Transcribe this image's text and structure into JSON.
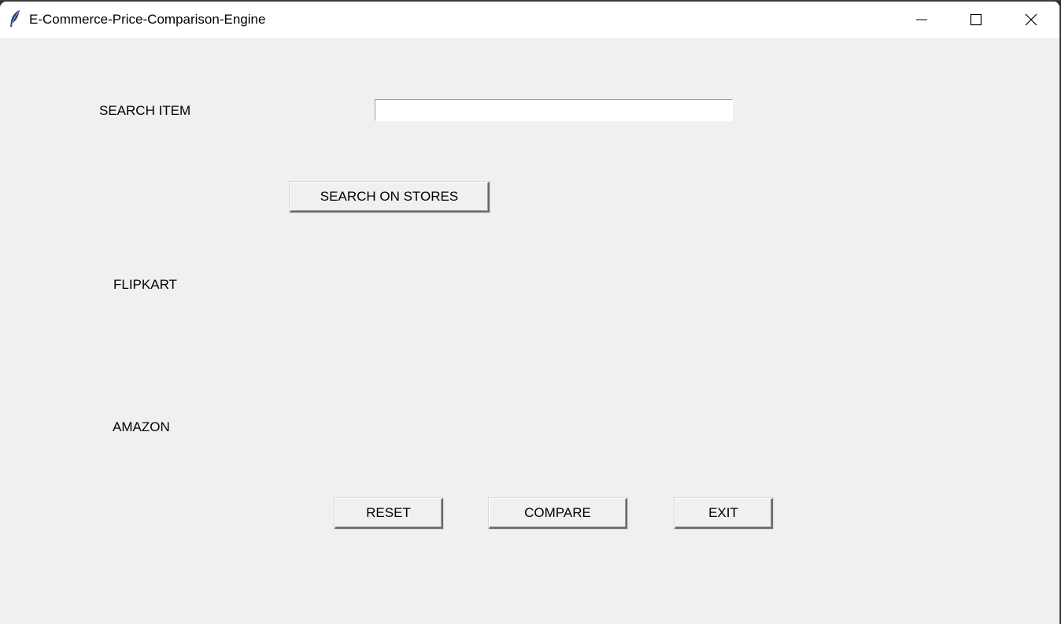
{
  "window": {
    "title": "E-Commerce-Price-Comparison-Engine",
    "app_icon": "feather-icon",
    "controls": {
      "minimize_icon": "minimize-icon",
      "maximize_icon": "maximize-icon",
      "close_icon": "close-icon"
    }
  },
  "form": {
    "search_label": "SEARCH ITEM",
    "search_value": "",
    "search_button_label": "SEARCH ON STORES",
    "flipkart_label": "FLIPKART",
    "amazon_label": "AMAZON"
  },
  "actions": {
    "reset_label": "RESET",
    "compare_label": "COMPARE",
    "exit_label": "EXIT"
  },
  "colors": {
    "window_background": "#f0f0f0",
    "titlebar_background": "#ffffff"
  }
}
